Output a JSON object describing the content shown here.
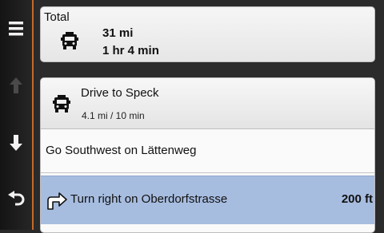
{
  "sidebar": {
    "menu_icon": "hamburger-menu-icon",
    "up_icon": "up-arrow-icon",
    "down_icon": "down-arrow-icon",
    "back_icon": "back-arrow-icon"
  },
  "colors": {
    "accent": "#c46a2a",
    "highlight": "#a7bde0"
  },
  "total": {
    "title": "Total",
    "distance": "31 mi",
    "time": "1 hr 4 min",
    "icon": "truck-icon"
  },
  "directions": {
    "drive": {
      "title": "Drive to Speck",
      "sub": "4.1 mi / 10 min",
      "icon": "truck-icon"
    },
    "step1": {
      "text": "Go Southwest on Lättenweg"
    },
    "step2": {
      "text": "Turn right on Oberdorfstrasse",
      "distance": "200 ft",
      "icon": "turn-right-icon"
    }
  }
}
